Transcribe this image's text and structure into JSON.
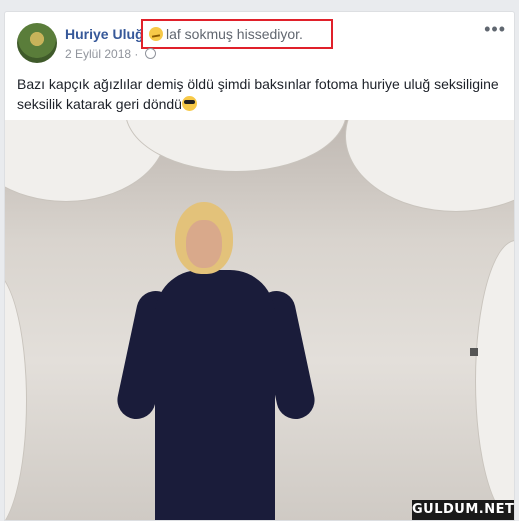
{
  "post": {
    "author": "Huriye Uluğ",
    "feeling": "laf sokmuş hissediyor.",
    "date": "2 Eylül 2018",
    "separator": "·",
    "more": "•••",
    "text": "Bazı kapçık ağızlılar demiş öldü şimdi baksınlar fotoma huriye uluğ seksiligine seksilik katarak geri döndü"
  },
  "watermark": "GULDUM.NET",
  "icons": {
    "feeling": "smirk-emoji-icon",
    "privacy": "globe-icon",
    "text_end": "sunglasses-emoji-icon"
  },
  "colors": {
    "author": "#365899",
    "highlight": "#e0202a"
  }
}
